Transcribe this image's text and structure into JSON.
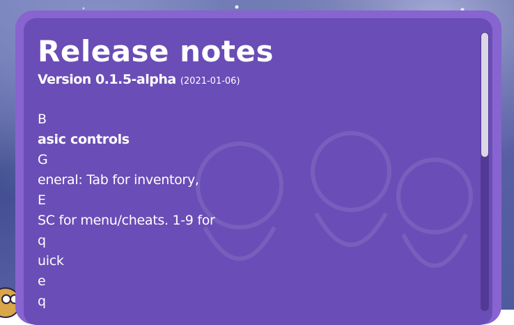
{
  "dialog": {
    "title": "Release notes",
    "version_label": "Version 0.1.5-alpha",
    "version_date": "(2021-01-06)"
  },
  "notes": {
    "lines": [
      "B",
      "asic controls",
      "G",
      "eneral: Tab for inventory,",
      "E",
      "SC for menu/cheats. 1-9 for",
      "q",
      "uick",
      "e",
      "q"
    ]
  },
  "colors": {
    "panel_frame": "#8764cf",
    "panel_body": "#6a4db6",
    "text": "#ffffff",
    "scrollbar_thumb": "#d9d6e6"
  },
  "icons": {
    "background_character": "owl-icon"
  }
}
